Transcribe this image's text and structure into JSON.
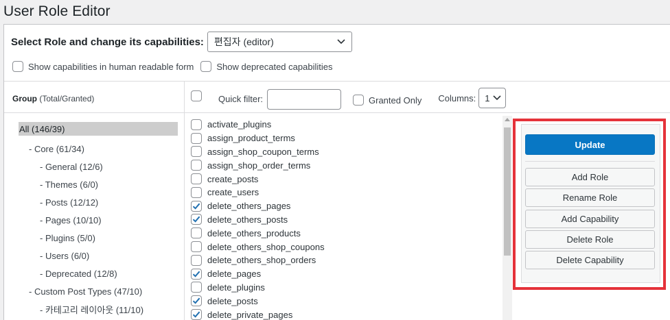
{
  "page": {
    "title": "User Role Editor"
  },
  "role_select": {
    "label": "Select Role and change its capabilities:",
    "value": "편집자 (editor)"
  },
  "options": {
    "human_readable": "Show capabilities in human readable form",
    "deprecated": "Show deprecated capabilities"
  },
  "group_header": {
    "title": "Group",
    "sub": "(Total/Granted)"
  },
  "filter": {
    "quick_filter_label": "Quick filter:",
    "quick_filter_value": "",
    "granted_only_label": "Granted Only",
    "columns_label": "Columns:",
    "columns_value": "1"
  },
  "groups": [
    {
      "label": "All (146/39)",
      "selected": true
    },
    {
      "label": "- Core (61/34)"
    },
    {
      "label": "- General (12/6)"
    },
    {
      "label": "- Themes (6/0)"
    },
    {
      "label": "- Posts (12/12)"
    },
    {
      "label": "- Pages (10/10)"
    },
    {
      "label": "- Plugins (5/0)"
    },
    {
      "label": "- Users (6/0)"
    },
    {
      "label": "- Deprecated (12/8)"
    },
    {
      "label": "- Custom Post Types (47/10)"
    },
    {
      "label": "- 카테고리 레이아웃 (11/10)"
    }
  ],
  "capabilities": [
    {
      "name": "activate_plugins",
      "checked": false
    },
    {
      "name": "assign_product_terms",
      "checked": false
    },
    {
      "name": "assign_shop_coupon_terms",
      "checked": false
    },
    {
      "name": "assign_shop_order_terms",
      "checked": false
    },
    {
      "name": "create_posts",
      "checked": false
    },
    {
      "name": "create_users",
      "checked": false
    },
    {
      "name": "delete_others_pages",
      "checked": true
    },
    {
      "name": "delete_others_posts",
      "checked": true
    },
    {
      "name": "delete_others_products",
      "checked": false
    },
    {
      "name": "delete_others_shop_coupons",
      "checked": false
    },
    {
      "name": "delete_others_shop_orders",
      "checked": false
    },
    {
      "name": "delete_pages",
      "checked": true
    },
    {
      "name": "delete_plugins",
      "checked": false
    },
    {
      "name": "delete_posts",
      "checked": true
    },
    {
      "name": "delete_private_pages",
      "checked": true
    }
  ],
  "actions": {
    "update": "Update",
    "add_role": "Add Role",
    "rename_role": "Rename Role",
    "add_capability": "Add Capability",
    "delete_role": "Delete Role",
    "delete_capability": "Delete Capability"
  },
  "colors": {
    "primary": "#0877c4",
    "highlight_border": "#e5323a",
    "check": "#2271b1"
  }
}
